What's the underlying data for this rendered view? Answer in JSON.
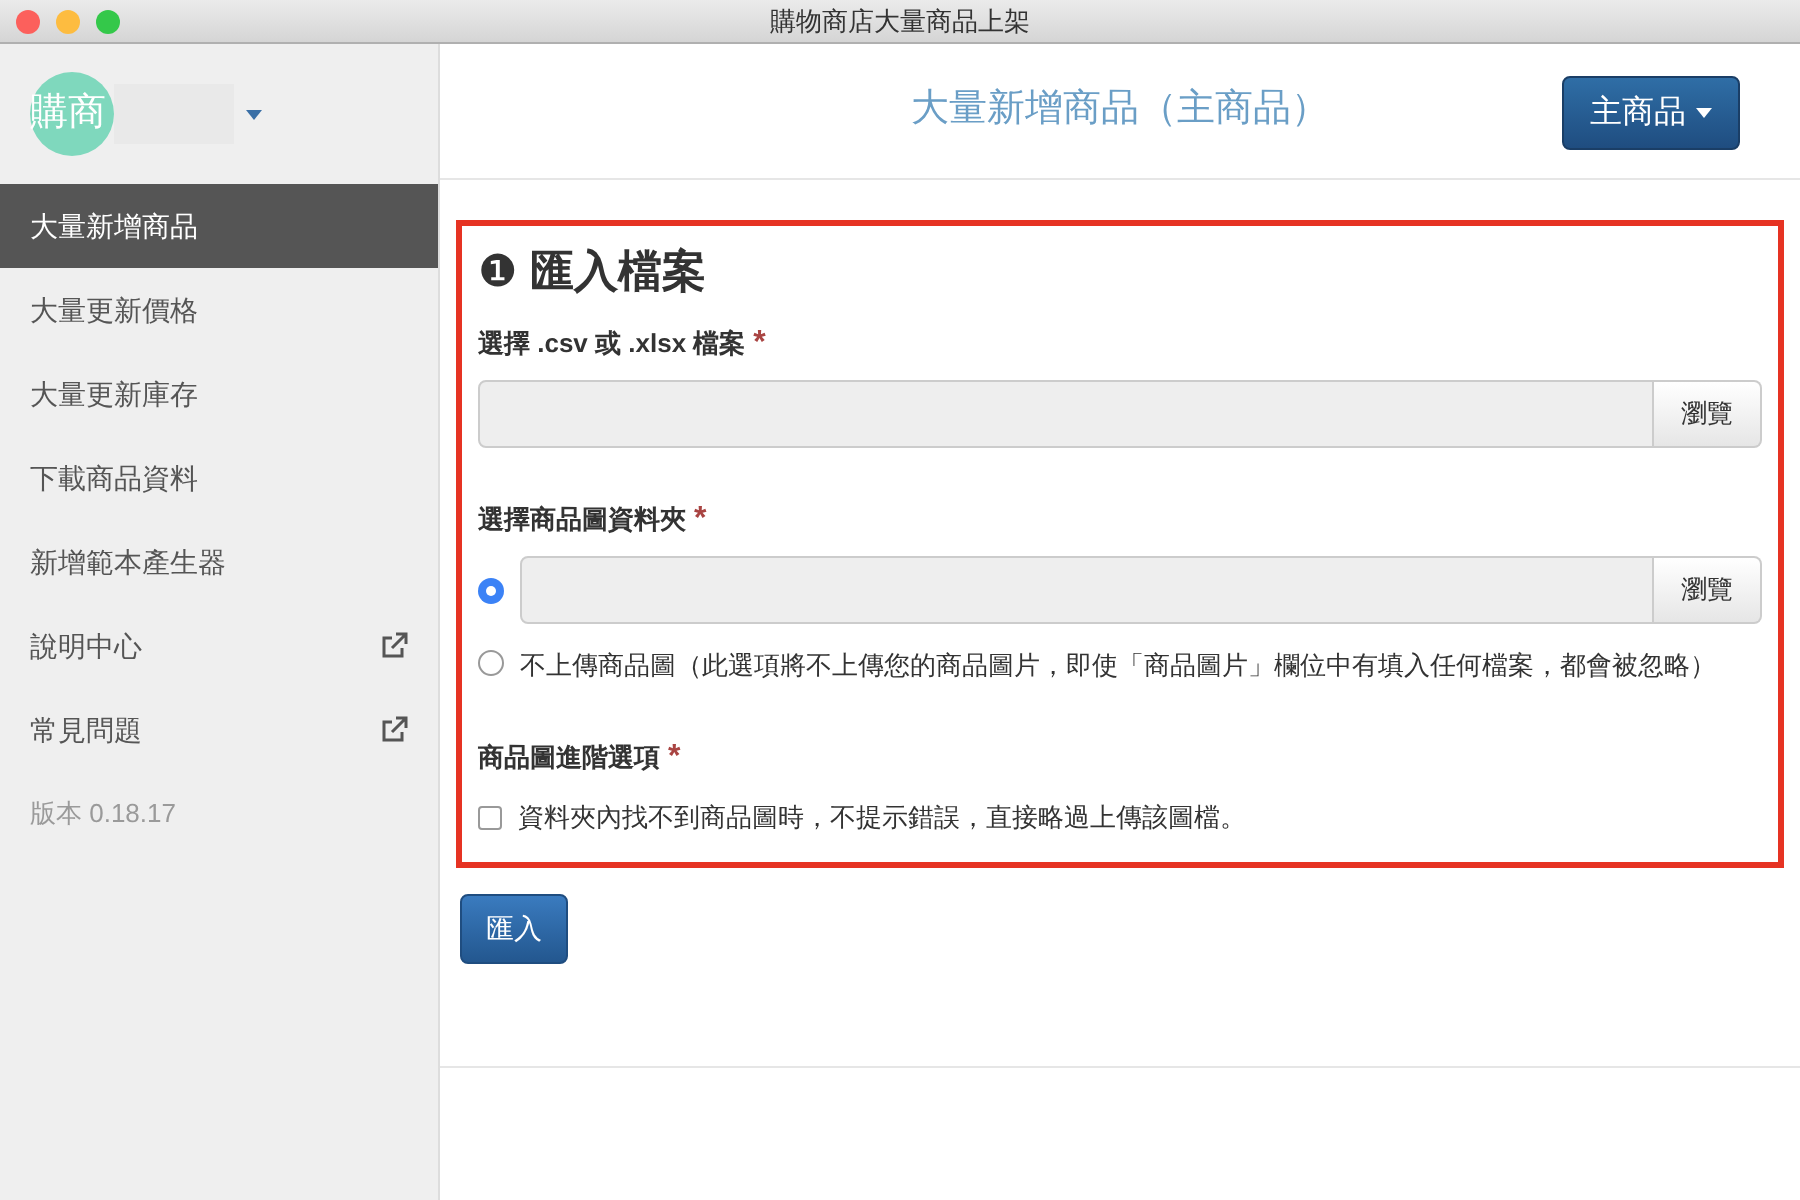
{
  "window": {
    "title": "購物商店大量商品上架"
  },
  "sidebar": {
    "logo_text": "購商",
    "items": [
      {
        "label": "大量新增商品",
        "selected": true,
        "external": false
      },
      {
        "label": "大量更新價格",
        "selected": false,
        "external": false
      },
      {
        "label": "大量更新庫存",
        "selected": false,
        "external": false
      },
      {
        "label": "下載商品資料",
        "selected": false,
        "external": false
      },
      {
        "label": "新增範本產生器",
        "selected": false,
        "external": false
      },
      {
        "label": "說明中心",
        "selected": false,
        "external": true
      },
      {
        "label": "常見問題",
        "selected": false,
        "external": true
      }
    ],
    "version": "版本 0.18.17"
  },
  "header": {
    "title": "大量新增商品（主商品）",
    "menu_button": "主商品"
  },
  "form": {
    "step_number": "❶",
    "heading": "匯入檔案",
    "file_field": {
      "label": "選擇 .csv 或 .xlsx 檔案",
      "required_mark": "*",
      "browse": "瀏覽"
    },
    "folder_field": {
      "label": "選擇商品圖資料夾",
      "required_mark": "*",
      "options": [
        {
          "kind": "file",
          "browse": "瀏覽",
          "selected": true
        },
        {
          "kind": "text",
          "label": "不上傳商品圖（此選項將不上傳您的商品圖片，即使「商品圖片」欄位中有填入任何檔案，都會被忽略）",
          "selected": false
        }
      ]
    },
    "advanced": {
      "label": "商品圖進階選項",
      "required_mark": "*",
      "checkbox": {
        "label": "資料夾內找不到商品圖時，不提示錯誤，直接略過上傳該圖檔。",
        "checked": false
      }
    }
  },
  "submit": "匯入"
}
